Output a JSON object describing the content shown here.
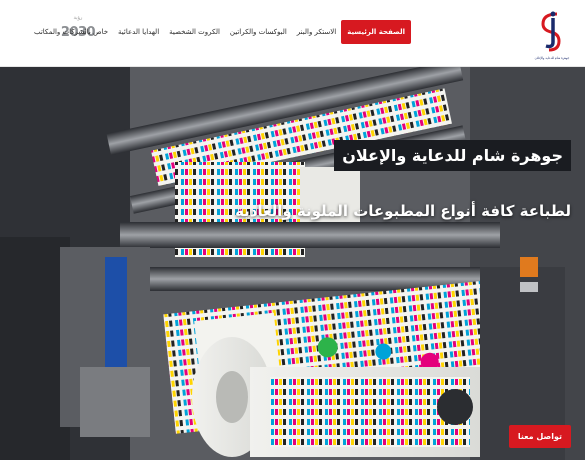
{
  "nav": {
    "items": [
      {
        "label": "الصفحة الرئيسية",
        "active": true
      },
      {
        "label": "الاستكر والبنر",
        "active": false
      },
      {
        "label": "البوكسات والكراتين",
        "active": false
      },
      {
        "label": "الكروت الشخصية",
        "active": false
      },
      {
        "label": "الهدايا الدعائية",
        "active": false
      },
      {
        "label": "خاص بالشركات والمكاتب",
        "active": false
      }
    ]
  },
  "vision": {
    "label": "رؤية",
    "year": "2030"
  },
  "brand": {
    "tagline": "جوهرة شام للدعاية والإعلان"
  },
  "hero": {
    "headline": "جوهرة شام للدعاية والإعلان",
    "subline": "لطباعة كافة أنواع المطبوعات الملونة والعادية",
    "cta_label": "تواصل معنا"
  },
  "colors": {
    "accent": "#d71920",
    "headline_bg": "#1a1c21",
    "brand_blue": "#1a2a6c"
  }
}
